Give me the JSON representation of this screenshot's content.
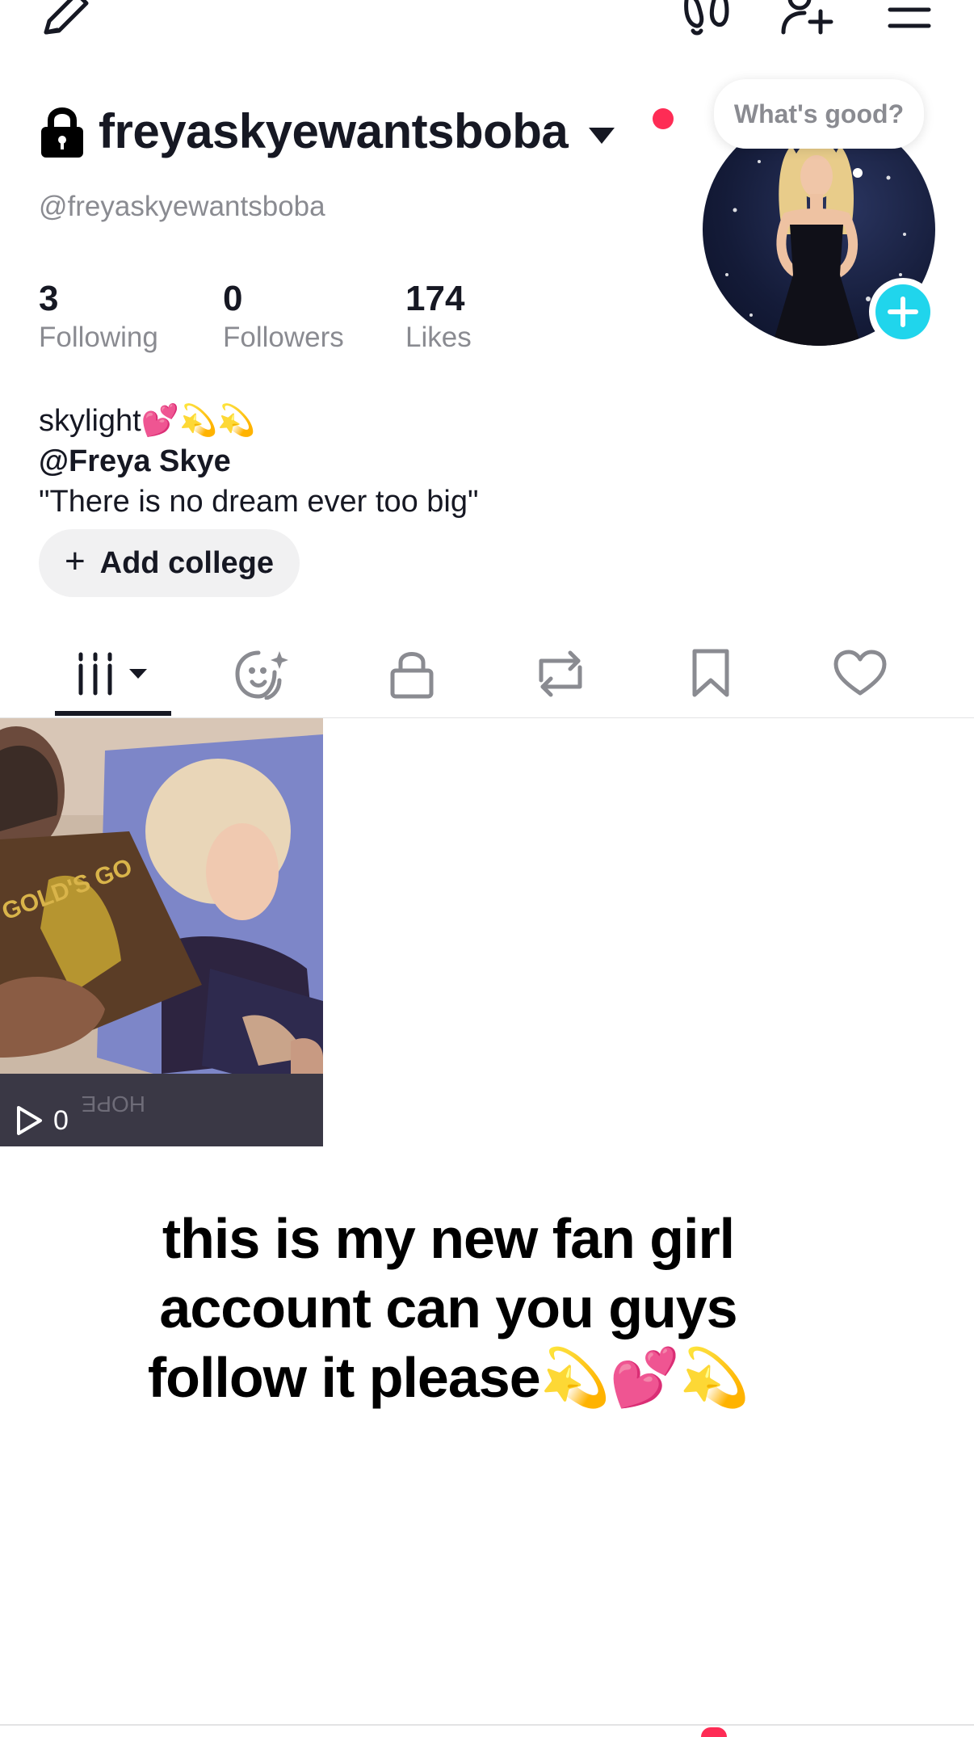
{
  "top_bar": {
    "edit_icon": "pencil-icon",
    "footprints_icon": "footprints-icon",
    "add_friend_icon": "add-user-icon",
    "menu_icon": "hamburger-menu-icon"
  },
  "profile": {
    "private_icon": "lock-icon",
    "username": "freyaskyewantsboba",
    "handle": "@freyaskyewantsboba",
    "avatar_bubble": "What's good?",
    "stats": [
      {
        "number": "3",
        "label": "Following"
      },
      {
        "number": "0",
        "label": "Followers"
      },
      {
        "number": "174",
        "label": "Likes"
      }
    ],
    "bio": {
      "line1": "skylight💕💫💫",
      "line2": "@Freya Skye",
      "line3": "\"There is no dream ever too big\""
    },
    "add_college": {
      "plus": "+",
      "label": "Add college"
    }
  },
  "tabs": [
    {
      "name": "videos",
      "icon": "grid-icon",
      "active": true
    },
    {
      "name": "stories",
      "icon": "face-sparkle-icon"
    },
    {
      "name": "private",
      "icon": "lock-icon"
    },
    {
      "name": "reposts",
      "icon": "repost-icon"
    },
    {
      "name": "favorites",
      "icon": "bookmark-icon"
    },
    {
      "name": "liked",
      "icon": "heart-icon"
    }
  ],
  "videos": [
    {
      "views": "0",
      "poster_text": "GOLD'S GO",
      "poster_text2": "HOPE"
    }
  ],
  "caption": {
    "line1": "this is my new fan girl",
    "line2": "account can you guys",
    "line3": "follow it please💫💕💫"
  },
  "colors": {
    "accent_red": "#fe2c55",
    "accent_cyan": "#20d5ec",
    "text_primary": "#161823",
    "text_secondary": "#8a8b91"
  }
}
